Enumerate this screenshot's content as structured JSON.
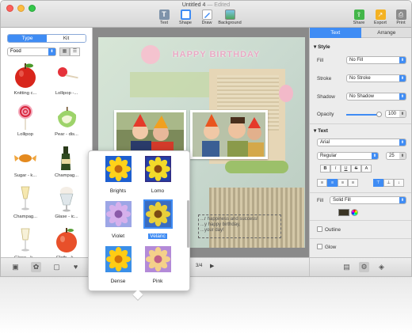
{
  "window": {
    "title": "Untitled 4",
    "status": "— Edited"
  },
  "toolbar": {
    "items": [
      {
        "label": "Text",
        "icon": "text-icon"
      },
      {
        "label": "Shape",
        "icon": "shape-icon"
      },
      {
        "label": "Draw",
        "icon": "pencil-icon"
      },
      {
        "label": "Background",
        "icon": "background-icon"
      }
    ],
    "right_items": [
      {
        "label": "Share",
        "icon": "share-icon"
      },
      {
        "label": "Export",
        "icon": "export-icon"
      },
      {
        "label": "Print",
        "icon": "printer-icon"
      }
    ]
  },
  "left_panel": {
    "tabs": [
      "Type",
      "Kit"
    ],
    "active_tab": "Type",
    "category": "Food",
    "clips": [
      {
        "label": "Knitting c...",
        "icon": "apple-icon"
      },
      {
        "label": "Lollipop -...",
        "icon": "lollipop-icon"
      },
      {
        "label": "Lollipop",
        "icon": "swirl-lollipop-icon"
      },
      {
        "label": "Pear - dis...",
        "icon": "pear-icon"
      },
      {
        "label": "Sugar - k...",
        "icon": "candy-icon"
      },
      {
        "label": "Champag...",
        "icon": "champagne-icon"
      },
      {
        "label": "Champag...",
        "icon": "champagne-glass-icon"
      },
      {
        "label": "Glase - ic...",
        "icon": "ice-cream-glass-icon"
      },
      {
        "label": "Glase - k...",
        "icon": "glass-icon"
      },
      {
        "label": "Cloth - k...",
        "icon": "cloth-apple-icon"
      }
    ]
  },
  "canvas": {
    "banner_text": "HAPPY BIRTHDAY",
    "textbox_lines": [
      "...r happiness and success!",
      "...y happy birthday,",
      "...your day!"
    ],
    "page_indicator": "3/4"
  },
  "inspector": {
    "tabs": [
      "Text",
      "Arrange"
    ],
    "active_tab": "Text",
    "style_header": "Style",
    "fill_label": "Fill",
    "fill_value": "No Fill",
    "stroke_label": "Stroke",
    "stroke_value": "No Stroke",
    "shadow_label": "Shadow",
    "shadow_value": "No Shadow",
    "opacity_label": "Opacity",
    "opacity_value": "100",
    "text_header": "Text",
    "font_family": "Arial",
    "font_style": "Regular",
    "font_size": "25",
    "text_fill_label": "Fill",
    "text_fill_value": "Solid Fill",
    "outline_label": "Outline",
    "glow_label": "Glow",
    "text_color": "#3a3424"
  },
  "popover": {
    "filters": [
      {
        "label": "Brights",
        "selected": false
      },
      {
        "label": "Lomo",
        "selected": false
      },
      {
        "label": "Violet",
        "selected": false
      },
      {
        "label": "Velanc",
        "selected": true
      },
      {
        "label": "Dense",
        "selected": false
      },
      {
        "label": "Pink",
        "selected": false
      }
    ]
  },
  "colors": {
    "accent": "#3f8cf4"
  }
}
